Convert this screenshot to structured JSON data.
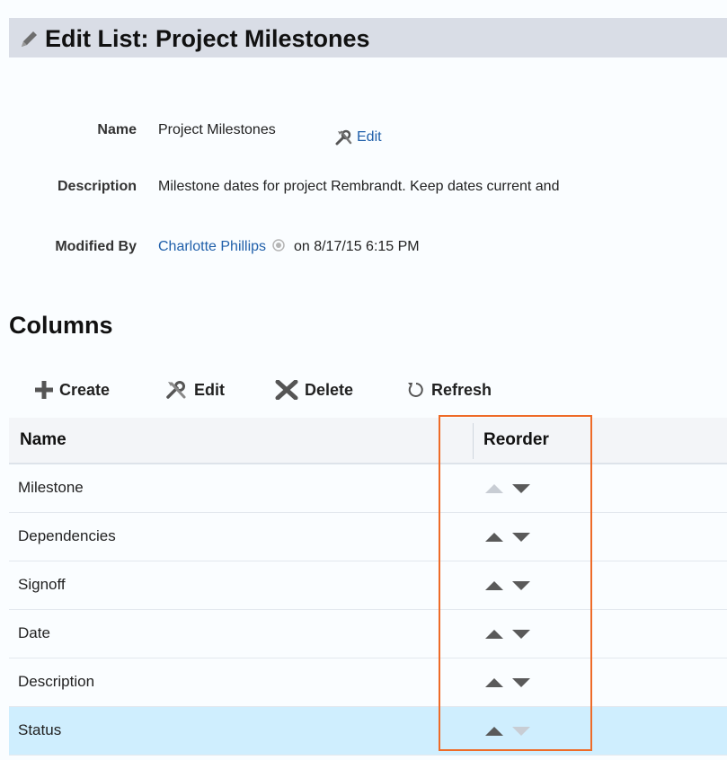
{
  "header": {
    "title": "Edit List: Project Milestones",
    "icon": "pencil-icon"
  },
  "properties": {
    "name_label": "Name",
    "name_value": "Project Milestones",
    "edit_link": "Edit",
    "description_label": "Description",
    "description_value": "Milestone dates for project Rembrandt. Keep dates current and",
    "modified_by_label": "Modified By",
    "modified_by_user": "Charlotte Phillips",
    "modified_on": "on 8/17/15 6:15 PM"
  },
  "columns_section": {
    "title": "Columns",
    "toolbar": {
      "create": "Create",
      "edit": "Edit",
      "delete": "Delete",
      "refresh": "Refresh"
    },
    "table": {
      "headers": {
        "name": "Name",
        "reorder": "Reorder"
      },
      "rows": [
        {
          "name": "Milestone",
          "up_enabled": false,
          "down_enabled": true,
          "selected": false
        },
        {
          "name": "Dependencies",
          "up_enabled": true,
          "down_enabled": true,
          "selected": false
        },
        {
          "name": "Signoff",
          "up_enabled": true,
          "down_enabled": true,
          "selected": false
        },
        {
          "name": "Date",
          "up_enabled": true,
          "down_enabled": true,
          "selected": false
        },
        {
          "name": "Description",
          "up_enabled": true,
          "down_enabled": true,
          "selected": false
        },
        {
          "name": "Status",
          "up_enabled": true,
          "down_enabled": false,
          "selected": true
        }
      ]
    }
  },
  "colors": {
    "link": "#1f5faa",
    "highlight_border": "#ee6b28",
    "selected_row": "#cfeefe",
    "title_bar": "#d9dde6"
  }
}
